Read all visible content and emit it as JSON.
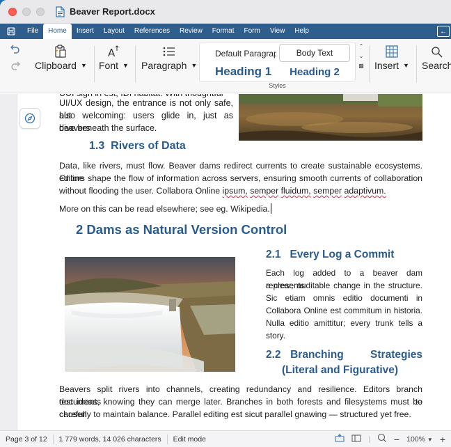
{
  "window": {
    "title": "Beaver Report.docx"
  },
  "menu": {
    "items": [
      "File",
      "Home",
      "Insert",
      "Layout",
      "References",
      "Review",
      "Format",
      "Form",
      "View",
      "Help"
    ],
    "active": "Home"
  },
  "ribbon": {
    "clipboard": "Clipboard",
    "font": "Font",
    "paragraph": "Paragraph",
    "insert": "Insert",
    "search": "Search",
    "styles": {
      "label": "Styles",
      "default": "Default Paragraph Style",
      "body": "Body Text",
      "heading1": "Heading 1",
      "heading2": "Heading 2"
    }
  },
  "document": {
    "top_partial": "UUI sign in  est, IDI habitat. With thoughtful",
    "intro_lines": [
      "UI/UX design, the entrance is not only safe, but",
      "also welcoming: users glide in, just as beavers",
      "dive beneath the surface."
    ],
    "h_1_3_num": "1.3",
    "h_1_3_title": "Rivers of Data",
    "rivers_lines": [
      "Data, like rivers, must flow. Beaver dams redirect currents to create sustainable ecosystems. Online",
      "editors shape the flow of information across servers, ensuring smooth currents of collaboration",
      "without flooding the user. Collabora Online ipsum, semper fluidum, semper adaptivum."
    ],
    "more_line": "More on this can be read elsewhere; see eg. Wikipedia.",
    "h_2": "2 Dams as Natural Version Control",
    "h_2_1_num": "2.1",
    "h_2_1_title": "Every Log a Commit",
    "commit_lines": [
      "Each log added to a beaver dam represents",
      "a clear, auditable change in the structure.",
      "Sic etiam omnis editio documenti in",
      "Collabora Online est commitum in historia.",
      "Nulla editio amittitur; every trunk tells a",
      "story."
    ],
    "h_2_2_num": "2.2",
    "h_2_2_line1": "Branching Strategies",
    "h_2_2_line2": "(Literal and Figurative)",
    "branch_lines": [
      "Beavers split rivers into channels, creating redundancy and resilience. Editors branch documents to",
      "test ideas, knowing they can merge later. Branches in both forests and filesystems must be chosen",
      "carefully to maintain balance. Parallel editing est sicut parallel gnawing — structured yet free."
    ]
  },
  "status": {
    "page": "Page 3 of 12",
    "words": "1 779 words, 14 026 characters",
    "mode": "Edit mode",
    "zoom": "100%"
  }
}
